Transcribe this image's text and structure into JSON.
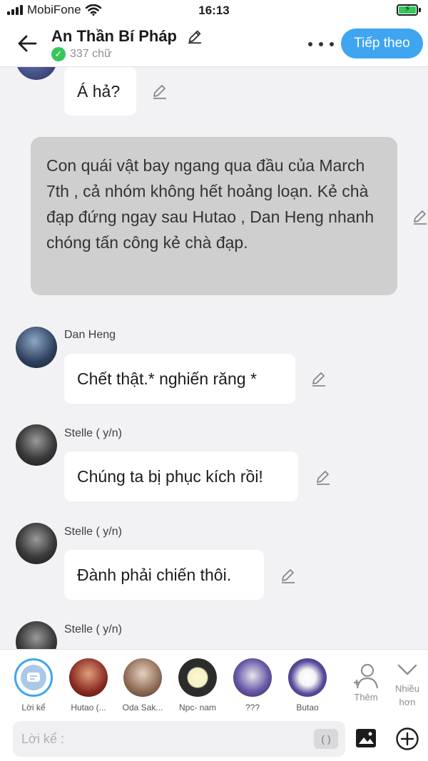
{
  "status": {
    "carrier": "MobiFone",
    "time": "16:13"
  },
  "header": {
    "title": "An Thần Bí Pháp",
    "word_count": "337 chữ",
    "next_label": "Tiếp theo"
  },
  "chat": {
    "top_message": "Á hả?",
    "narration": "Con quái vật bay ngang qua đầu của March 7th , cả nhóm không hết hoảng loạn. Kẻ chà đạp đứng ngay sau Hutao , Dan Heng nhanh chóng tấn công kẻ chà đạp.",
    "messages": [
      {
        "speaker": "Dan Heng",
        "text": "Chết thật.* nghiến răng *"
      },
      {
        "speaker": "Stelle ( y/n)",
        "text": "Chúng ta bị phục kích rồi!"
      },
      {
        "speaker": "Stelle ( y/n)",
        "text": "Đành phải chiến thôi."
      },
      {
        "speaker": "Stelle ( y/n)",
        "text": ""
      }
    ]
  },
  "characters": [
    {
      "label": "Lời kể"
    },
    {
      "label": "Hutao (..."
    },
    {
      "label": "Oda Sak..."
    },
    {
      "label": "Npc- nam"
    },
    {
      "label": "???"
    },
    {
      "label": "Butao"
    }
  ],
  "actions": {
    "add_label": "Thêm",
    "more_label_1": "Nhiều",
    "more_label_2": "hơn"
  },
  "composer": {
    "placeholder": "Lời kể :",
    "paren_label": "( )"
  },
  "colors": {
    "accent": "#3fa5f0",
    "narration_bg": "#cfcfcf",
    "check": "#34c759"
  }
}
